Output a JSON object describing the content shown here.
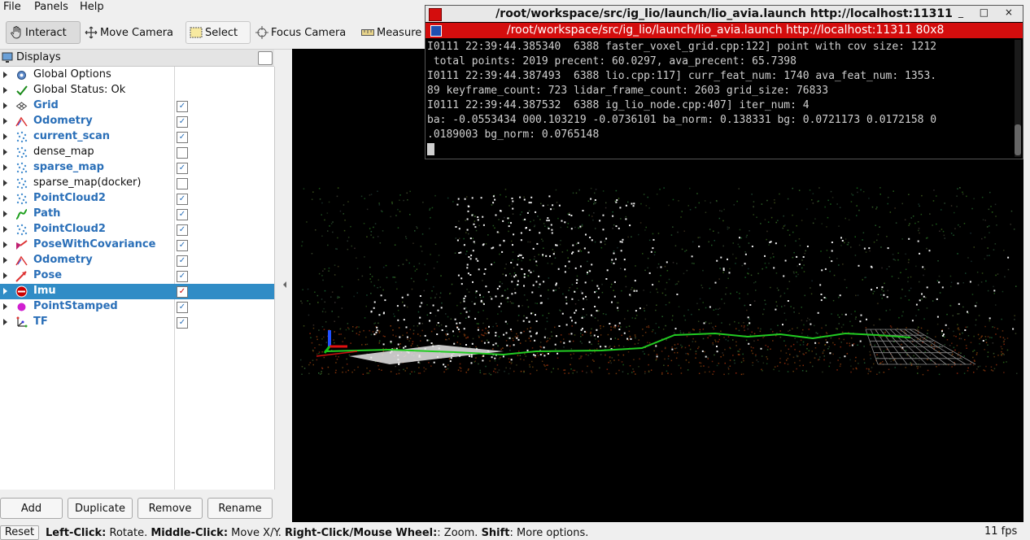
{
  "menu": {
    "items": [
      "File",
      "Panels",
      "Help"
    ]
  },
  "toolbar": {
    "tools": [
      {
        "label": "Interact",
        "icon": "hand-icon"
      },
      {
        "label": "Move Camera",
        "icon": "move-icon"
      },
      {
        "label": "Select",
        "icon": "select-box-icon"
      },
      {
        "label": "Focus Camera",
        "icon": "crosshair-icon"
      },
      {
        "label": "Measure",
        "icon": "ruler-icon"
      }
    ]
  },
  "displays": {
    "title": "Displays",
    "items": [
      {
        "label": "Global Options",
        "icon": "gear-icon",
        "checked": null,
        "bold": false
      },
      {
        "label": "Global Status: Ok",
        "icon": "checkmark-icon",
        "checked": null,
        "bold": false
      },
      {
        "label": "Grid",
        "icon": "grid-icon",
        "checked": true,
        "bold": true
      },
      {
        "label": "Odometry",
        "icon": "odometry-icon",
        "checked": true,
        "bold": true
      },
      {
        "label": "current_scan",
        "icon": "pointcloud-icon",
        "checked": true,
        "bold": true
      },
      {
        "label": "dense_map",
        "icon": "pointcloud-icon",
        "checked": false,
        "bold": false
      },
      {
        "label": "sparse_map",
        "icon": "pointcloud-icon",
        "checked": true,
        "bold": true
      },
      {
        "label": "sparse_map(docker)",
        "icon": "pointcloud-icon",
        "checked": false,
        "bold": false
      },
      {
        "label": "PointCloud2",
        "icon": "pointcloud-icon",
        "checked": true,
        "bold": true
      },
      {
        "label": "Path",
        "icon": "path-icon",
        "checked": true,
        "bold": true
      },
      {
        "label": "PointCloud2",
        "icon": "pointcloud-icon",
        "checked": true,
        "bold": true
      },
      {
        "label": "PoseWithCovariance",
        "icon": "pose-covariance-icon",
        "checked": true,
        "bold": true
      },
      {
        "label": "Odometry",
        "icon": "odometry-icon",
        "checked": true,
        "bold": true
      },
      {
        "label": "Pose",
        "icon": "pose-icon",
        "checked": true,
        "bold": true
      },
      {
        "label": "Imu",
        "icon": "imu-icon",
        "checked": true,
        "bold": true,
        "selected": true
      },
      {
        "label": "PointStamped",
        "icon": "point-icon",
        "checked": true,
        "bold": true
      },
      {
        "label": "TF",
        "icon": "tf-icon",
        "checked": true,
        "bold": true
      }
    ],
    "buttons": [
      "Add",
      "Duplicate",
      "Remove",
      "Rename"
    ]
  },
  "terminal": {
    "title": "/root/workspace/src/ig_lio/launch/lio_avia.launch http://localhost:11311",
    "tab": "/root/workspace/src/ig_lio/launch/lio_avia.launch http://localhost:11311 80x8",
    "window_buttons": "_ □ ×",
    "lines": [
      "I0111 22:39:44.385340  6388 faster_voxel_grid.cpp:122] point with cov size: 1212",
      " total points: 2019 precent: 60.0297, ava_precent: 65.7398",
      "I0111 22:39:44.387493  6388 lio.cpp:117] curr_feat_num: 1740 ava_feat_num: 1353.",
      "89 keyframe_count: 723 lidar_frame_count: 2603 grid_size: 76833",
      "I0111 22:39:44.387532  6388 ig_lio_node.cpp:407] iter_num: 4",
      "ba: -0.0553434 000.103219 -0.0736101 ba_norm: 0.138331 bg: 0.0721173 0.0172158 0",
      ".0189003 bg_norm: 0.0765148"
    ]
  },
  "status": {
    "reset": "Reset",
    "hint_parts": [
      {
        "text": "Left-Click:",
        "bold": true
      },
      {
        "text": " Rotate. ",
        "bold": false
      },
      {
        "text": "Middle-Click:",
        "bold": true
      },
      {
        "text": " Move X/Y. ",
        "bold": false
      },
      {
        "text": "Right-Click/Mouse Wheel:",
        "bold": true
      },
      {
        "text": ": Zoom. ",
        "bold": false
      },
      {
        "text": "Shift",
        "bold": true
      },
      {
        "text": ": More options.",
        "bold": false
      }
    ],
    "fps": "11 fps"
  },
  "colors": {
    "accent_selected": "#308cc6",
    "display_label": "#2a6fb8",
    "terminal_tab": "#d40d0d",
    "path": "#22cc22"
  }
}
